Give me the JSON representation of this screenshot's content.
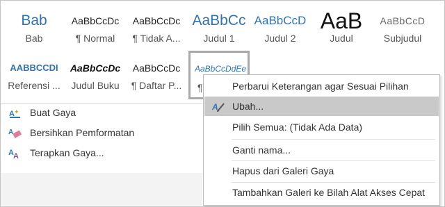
{
  "gallery": {
    "row1": [
      {
        "preview": "Bab",
        "label": "Bab"
      },
      {
        "preview": "AaBbCcDc",
        "label": "¶ Normal"
      },
      {
        "preview": "AaBbCcDc",
        "label": "¶ Tidak A..."
      },
      {
        "preview": "AaBbCc",
        "label": "Judul 1"
      },
      {
        "preview": "AaBbCcD",
        "label": "Judul 2"
      },
      {
        "preview": "AaB",
        "label": "Judul"
      },
      {
        "preview": "AaBbCcD",
        "label": "Subjudul"
      }
    ],
    "row2": [
      {
        "preview": "AABBCCDI",
        "label": "Referensi ..."
      },
      {
        "preview": "AaBbCcDc",
        "label": "Judul Buku"
      },
      {
        "preview": "AaBbCcDc",
        "label": "¶ Daftar P..."
      },
      {
        "preview": "AaBbCcDdEe",
        "label": "¶"
      }
    ]
  },
  "left_menu": [
    {
      "label": "Buat Gaya",
      "icon": "create-style-icon"
    },
    {
      "label": "Bersihkan Pemformatan",
      "icon": "clear-formatting-icon"
    },
    {
      "label": "Terapkan Gaya...",
      "icon": "apply-styles-icon"
    }
  ],
  "context_menu": [
    {
      "label": "Perbarui Keterangan agar Sesuai Pilihan"
    },
    {
      "label": "Ubah...",
      "icon": "modify-style-icon"
    },
    {
      "label": "Pilih Semua: (Tidak Ada Data)"
    },
    {
      "label": "Ganti nama..."
    },
    {
      "label": "Hapus dari Galeri Gaya"
    },
    {
      "label": "Tambahkan Galeri ke Bilah Alat Akses Cepat"
    }
  ],
  "colors": {
    "accent": "#2e74b5",
    "hover": "#c9c9c9"
  }
}
